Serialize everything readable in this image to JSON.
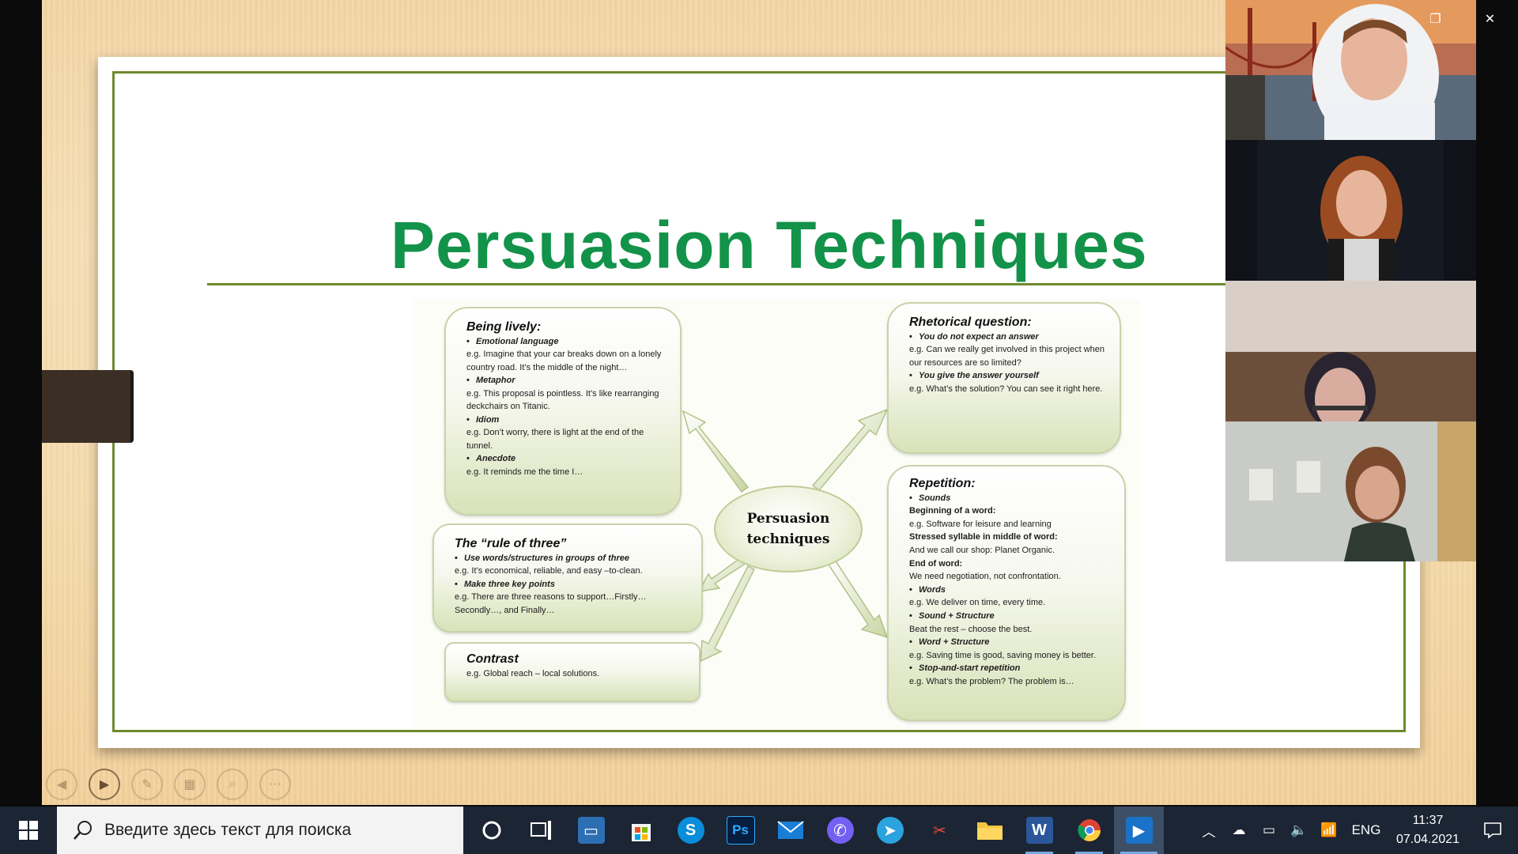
{
  "slide": {
    "title": "Persuasion Techniques",
    "center": [
      "Persuasion",
      "techniques"
    ]
  },
  "boxes": {
    "lively": {
      "heading": "Being lively:",
      "items": [
        {
          "bullet": "Emotional language",
          "example": "e.g. Imagine that your car breaks down on a lonely country road. It’s the middle of the night…"
        },
        {
          "bullet": "Metaphor",
          "example": "e.g. This proposal is pointless. It’s like rearranging deckchairs on Titanic."
        },
        {
          "bullet": "Idiom",
          "example": "e.g. Don’t worry, there is light at the end of the tunnel."
        },
        {
          "bullet": "Anecdote",
          "example": "e.g. It reminds me the time I…"
        }
      ]
    },
    "three": {
      "heading": "The “rule of three”",
      "items": [
        {
          "bullet": "Use words/structures in groups of three",
          "example": "e.g. It’s economical, reliable, and easy –to-clean."
        },
        {
          "bullet": "Make three key points",
          "example": "e.g. There are three reasons to support…Firstly… Secondly…, and Finally…"
        }
      ]
    },
    "contrast": {
      "heading": "Contrast",
      "example": "e.g. Global reach – local solutions."
    },
    "rhetorical": {
      "heading": "Rhetorical question:",
      "items": [
        {
          "bullet": "You do not expect an answer",
          "example": "e.g. Can we really get involved in this project when our resources are so limited?"
        },
        {
          "bullet": "You give the answer yourself",
          "example": "e.g. What’s the solution? You can see it right here."
        }
      ]
    },
    "repetition": {
      "heading": "Repetition:",
      "sounds": "Sounds",
      "sub": [
        {
          "label": "Beginning of a word:",
          "example": "e.g. Software for leisure and learning"
        },
        {
          "label": "Stressed syllable in middle of word:",
          "example": "And we call our shop: Planet Organic."
        },
        {
          "label": "End of word:",
          "example": "We need negotiation, not confrontation."
        }
      ],
      "items": [
        {
          "bullet": "Words",
          "example": "e.g. We deliver on time, every time."
        },
        {
          "bullet": "Sound + Structure",
          "example": "Beat the rest – choose the best."
        },
        {
          "bullet": "Word + Structure",
          "example": "e.g. Saving time is good, saving money is better."
        },
        {
          "bullet": "Stop-and-start repetition",
          "example": "e.g. What’s the problem? The problem is…"
        }
      ]
    }
  },
  "taskbar": {
    "search_placeholder": "Введите здесь текст для поиска",
    "lang": "ENG",
    "time": "11:37",
    "date": "07.04.2021",
    "apps": [
      "cortana",
      "task-view",
      "laptop",
      "store",
      "skype",
      "photoshop",
      "mail",
      "viber",
      "telegram",
      "snipping",
      "explorer",
      "word",
      "chrome",
      "media-player"
    ]
  },
  "colors": {
    "title_green": "#13924a",
    "frame_olive": "#6e8a2c",
    "taskbar": "#1b2533"
  }
}
